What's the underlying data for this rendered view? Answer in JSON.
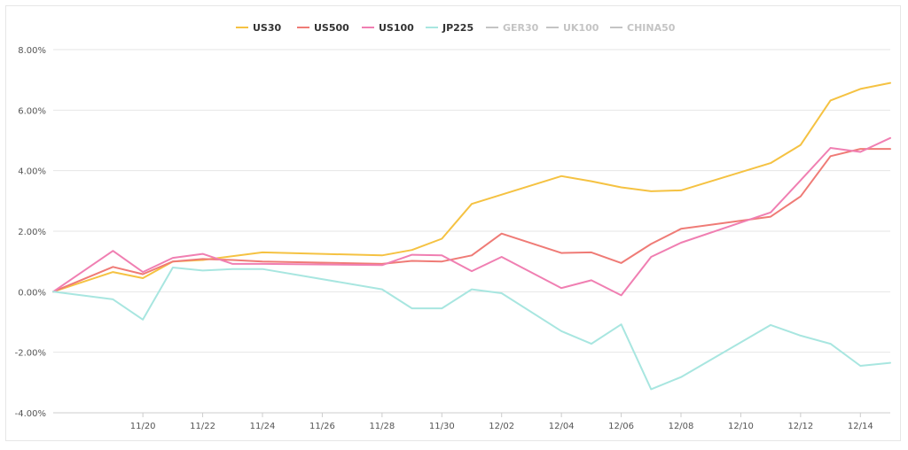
{
  "chart_data": {
    "type": "line",
    "title": "",
    "xlabel": "",
    "ylabel": "",
    "ylim": [
      -4,
      8
    ],
    "y_ticks": [
      "8.00%",
      "6.00%",
      "4.00%",
      "2.00%",
      "0.00%",
      "-2.00%",
      "-4.00%"
    ],
    "y_tick_values": [
      8,
      6,
      4,
      2,
      0,
      -2,
      -4
    ],
    "x_ticks": [
      "11/20",
      "11/22",
      "11/24",
      "11/26",
      "11/28",
      "11/30",
      "12/02",
      "12/04",
      "12/06",
      "12/08",
      "12/10",
      "12/12",
      "12/14"
    ],
    "x_tick_days": [
      3,
      5,
      7,
      9,
      11,
      13,
      15,
      17,
      19,
      21,
      23,
      25,
      27
    ],
    "x_days_ref": "day index where 11/17 = 0",
    "legend_position": "top-center",
    "grid": true,
    "series": [
      {
        "name": "US30",
        "color": "#f5c242",
        "visible": true,
        "x": [
          0,
          2,
          3,
          4,
          5,
          7,
          11,
          12,
          13,
          14,
          17,
          18,
          19,
          20,
          21,
          24,
          25,
          26,
          27,
          28
        ],
        "values": [
          0,
          0.65,
          0.45,
          1.0,
          1.05,
          1.3,
          1.2,
          1.38,
          1.75,
          2.9,
          3.82,
          3.65,
          3.45,
          3.32,
          3.35,
          4.25,
          4.85,
          6.32,
          6.7,
          6.9
        ]
      },
      {
        "name": "US500",
        "color": "#ef7b76",
        "visible": true,
        "x": [
          0,
          2,
          3,
          4,
          5,
          6,
          7,
          11,
          12,
          13,
          14,
          15,
          17,
          18,
          19,
          20,
          21,
          24,
          25,
          26,
          27,
          28
        ],
        "values": [
          0,
          0.82,
          0.58,
          1.0,
          1.08,
          1.05,
          1.0,
          0.92,
          1.02,
          1.0,
          1.2,
          1.92,
          1.28,
          1.3,
          0.95,
          1.58,
          2.08,
          2.48,
          3.15,
          4.48,
          4.72,
          4.72
        ]
      },
      {
        "name": "US100",
        "color": "#f07fb2",
        "visible": true,
        "x": [
          0,
          2,
          3,
          4,
          5,
          6,
          7,
          11,
          12,
          13,
          14,
          15,
          17,
          18,
          19,
          20,
          21,
          24,
          25,
          26,
          27,
          28
        ],
        "values": [
          0,
          1.35,
          0.65,
          1.12,
          1.25,
          0.92,
          0.92,
          0.88,
          1.22,
          1.2,
          0.68,
          1.15,
          0.12,
          0.38,
          -0.12,
          1.15,
          1.62,
          2.62,
          3.68,
          4.75,
          4.62,
          5.08
        ]
      },
      {
        "name": "JP225",
        "color": "#a8e6e0",
        "visible": true,
        "x": [
          0,
          2,
          3,
          4,
          5,
          6,
          7,
          11,
          12,
          13,
          14,
          15,
          17,
          18,
          19,
          20,
          21,
          24,
          25,
          26,
          27,
          28
        ],
        "values": [
          0,
          -0.25,
          -0.92,
          0.8,
          0.7,
          0.75,
          0.75,
          0.08,
          -0.55,
          -0.55,
          0.08,
          -0.05,
          -1.3,
          -1.72,
          -1.08,
          -3.22,
          -2.82,
          -1.1,
          -1.45,
          -1.72,
          -2.45,
          -2.35
        ]
      },
      {
        "name": "GER30",
        "color": "#c4c4c4",
        "visible": false,
        "x": [],
        "values": []
      },
      {
        "name": "UK100",
        "color": "#c4c4c4",
        "visible": false,
        "x": [],
        "values": []
      },
      {
        "name": "CHINA50",
        "color": "#c4c4c4",
        "visible": false,
        "x": [],
        "values": []
      }
    ]
  }
}
